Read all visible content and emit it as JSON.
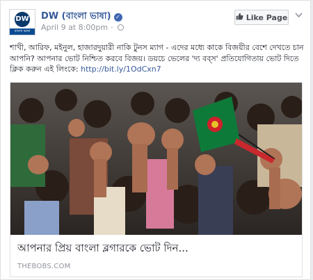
{
  "post": {
    "page_name": "DW (বাংলা ভাষা)",
    "timestamp": "April 9 at 8:00pm",
    "like_button_label": "Like Page",
    "text": "শাখী, আরিফ, মইনুল, হাজারদুয়ারী নাকি টুনস ম্যাগ - এদের মধ্যে কাকে বিজয়ীর বেশে দেখতে চান আপনি? আপনার ভোট নিশ্চিত করবে বিজয়। ডয়চে ভেলের 'দ্য বব্স' প্রতিযোগিতায় ভোট দিতে ক্লিক করুন এই লিংকে:",
    "link_url_text": "http://bit.ly/1OdCxn7"
  },
  "avatar": {
    "logo_text": "DW",
    "bar_text": "বাংলা ভাষা"
  },
  "attachment": {
    "title": "আপনার প্রিয় বাংলা ব্লগারকে ভোট দিন...",
    "domain": "THEBOBS.COM"
  },
  "icons": {
    "verified": "verified-badge-icon",
    "globe": "globe-icon",
    "thumb": "thumbs-up-icon",
    "chevron": "chevron-down-icon"
  },
  "colors": {
    "link": "#365899",
    "brand_blue": "#4267b2",
    "meta_gray": "#90949c",
    "text": "#1d2129"
  }
}
